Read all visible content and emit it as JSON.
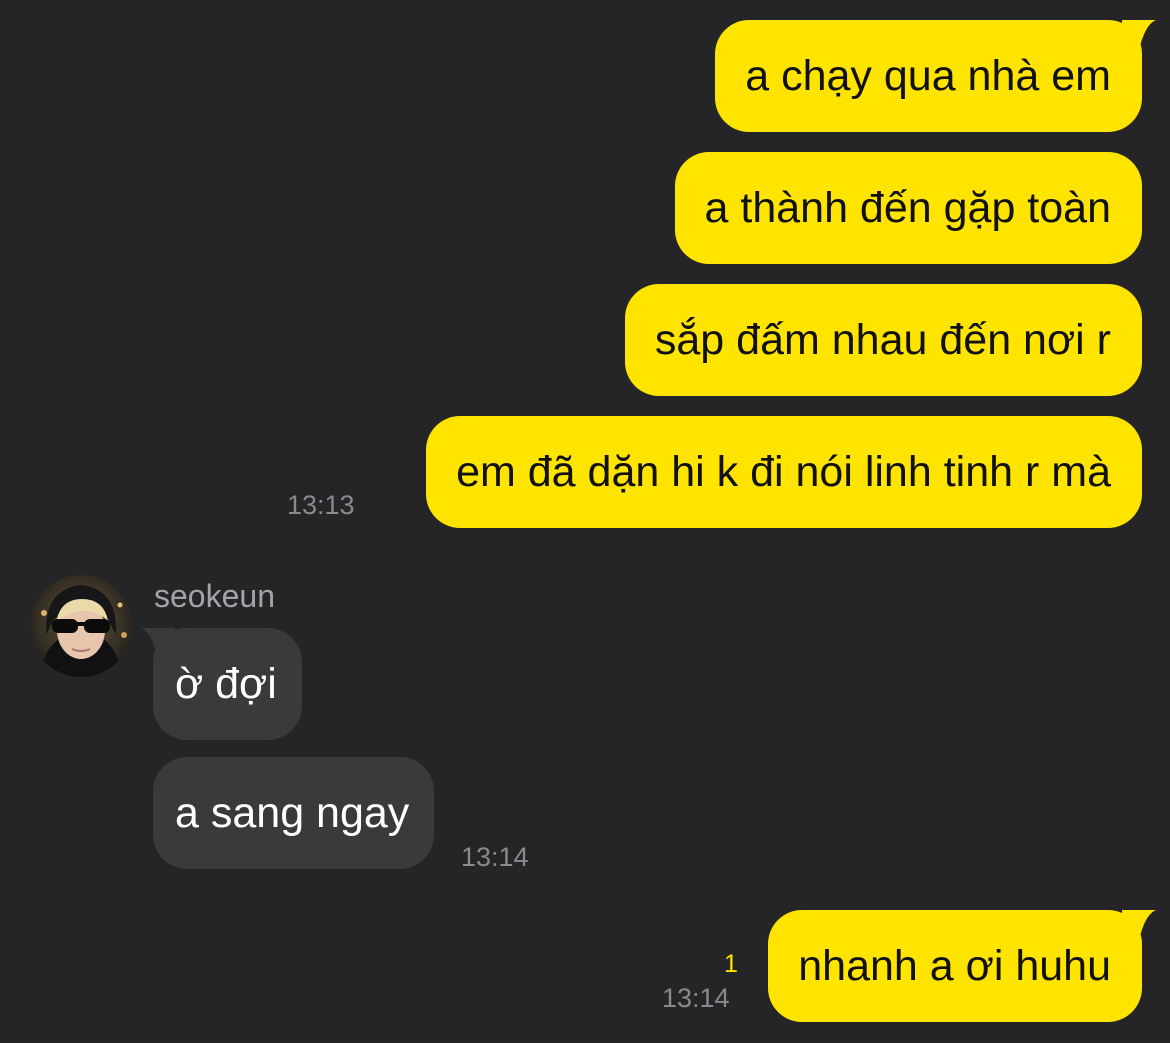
{
  "chat": {
    "sent_group_1": {
      "messages": [
        "a chạy qua nhà em",
        "a thành đến gặp toàn",
        "sắp đấm nhau đến nơi r",
        "em đã dặn hi k đi nói linh tinh r mà"
      ],
      "time": "13:13"
    },
    "received_group": {
      "sender": "seokeun",
      "messages": [
        "ờ đợi",
        "a sang ngay"
      ],
      "time": "13:14"
    },
    "sent_group_2": {
      "messages": [
        "nhanh a ơi huhu"
      ],
      "unread_count": "1",
      "time": "13:14"
    }
  },
  "colors": {
    "background": "#252528",
    "sent_bubble": "#ffe400",
    "received_bubble": "#3a3a3d",
    "timestamp": "#8a8a8e",
    "unread_count": "#ffe400"
  }
}
